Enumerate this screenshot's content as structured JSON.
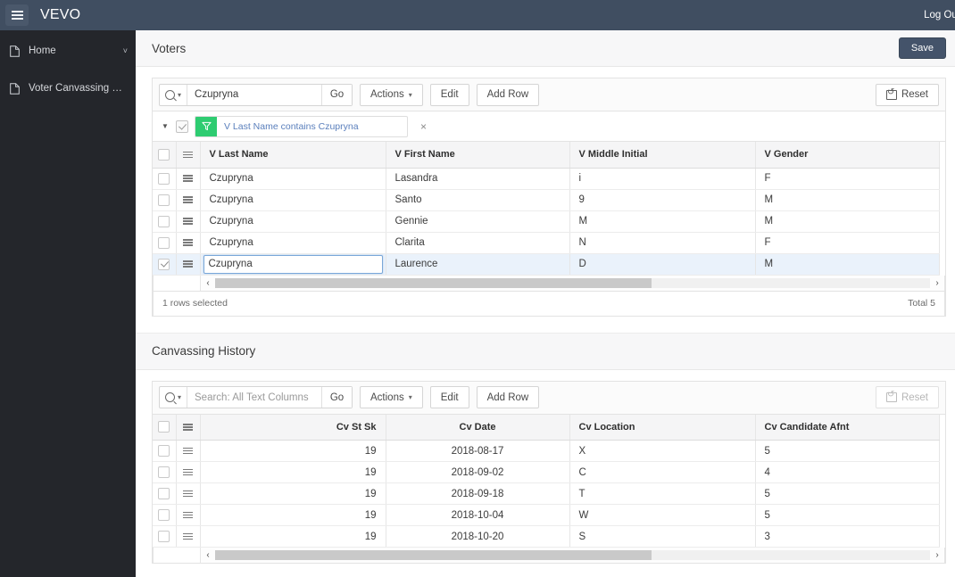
{
  "topbar": {
    "menu_icon": "hamburger-icon",
    "app_title": "VEVO",
    "logout_label": "Log Out"
  },
  "sidebar": {
    "items": [
      {
        "label": "Home",
        "icon": "page-icon",
        "caret": "˅"
      },
      {
        "label": "Voter Canvassing Maint…",
        "icon": "page-icon"
      }
    ]
  },
  "voters": {
    "title": "Voters",
    "save_label": "Save",
    "toolbar": {
      "search_icon": "search-icon",
      "search_value": "Czupryna",
      "search_placeholder": "Search: All Text Columns",
      "go_label": "Go",
      "actions_label": "Actions",
      "edit_label": "Edit",
      "add_row_label": "Add Row",
      "reset_label": "Reset"
    },
    "filter": {
      "chip_text": "V Last Name contains Czupryna",
      "close_label": "×",
      "enabled": true
    },
    "columns": [
      "V Last Name",
      "V First Name",
      "V Middle Initial",
      "V Gender"
    ],
    "rows": [
      {
        "selected": false,
        "editing": false,
        "cells": [
          "Czupryna",
          "Lasandra",
          "i",
          "F"
        ]
      },
      {
        "selected": false,
        "editing": false,
        "cells": [
          "Czupryna",
          "Santo",
          "9",
          "M"
        ]
      },
      {
        "selected": false,
        "editing": false,
        "cells": [
          "Czupryna",
          "Gennie",
          "M",
          "M"
        ]
      },
      {
        "selected": false,
        "editing": false,
        "cells": [
          "Czupryna",
          "Clarita",
          "N",
          "F"
        ]
      },
      {
        "selected": true,
        "editing": true,
        "cells": [
          "Czupryna",
          "Laurence",
          "D",
          "M"
        ]
      }
    ],
    "footer": {
      "rows_selected": "1 rows selected",
      "total": "Total 5"
    },
    "scroll": {
      "left_arrow": "‹",
      "right_arrow": "›",
      "thumb_pct": 61
    }
  },
  "canvassing": {
    "title": "Canvassing History",
    "toolbar": {
      "search_icon": "search-icon",
      "search_value": "",
      "search_placeholder": "Search: All Text Columns",
      "go_label": "Go",
      "actions_label": "Actions",
      "edit_label": "Edit",
      "add_row_label": "Add Row",
      "reset_label": "Reset",
      "reset_disabled": true
    },
    "columns": [
      "Cv St Sk",
      "Cv Date",
      "Cv Location",
      "Cv Candidate Afnt"
    ],
    "rows": [
      {
        "cells": [
          "19",
          "2018-08-17",
          "X",
          "5"
        ]
      },
      {
        "cells": [
          "19",
          "2018-09-02",
          "C",
          "4"
        ]
      },
      {
        "cells": [
          "19",
          "2018-09-18",
          "T",
          "5"
        ]
      },
      {
        "cells": [
          "19",
          "2018-10-04",
          "W",
          "5"
        ]
      },
      {
        "cells": [
          "19",
          "2018-10-20",
          "S",
          "3"
        ]
      }
    ],
    "scroll": {
      "left_arrow": "‹",
      "right_arrow": "›",
      "thumb_pct": 61
    }
  },
  "colors": {
    "topbar": "#404e61",
    "sidebar": "#24262b",
    "accent_green": "#2ecc71",
    "link_blue": "#5a7fbc",
    "save_button": "#44536a",
    "selected_row": "#eaf2fb"
  }
}
